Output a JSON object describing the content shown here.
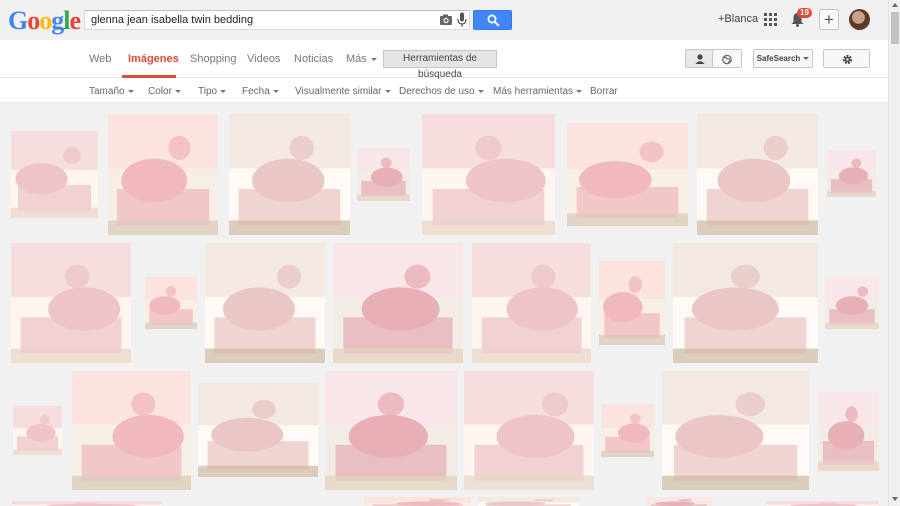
{
  "logo": {
    "letters": [
      "G",
      "o",
      "o",
      "g",
      "l",
      "e"
    ],
    "colors": [
      "#4285f4",
      "#ea4335",
      "#fbbc05",
      "#4285f4",
      "#34a853",
      "#ea4335"
    ]
  },
  "search": {
    "query": "glenna jean isabella twin bedding"
  },
  "header": {
    "user_link": "+Blanca",
    "notification_count": "19"
  },
  "nav": {
    "tabs": [
      {
        "label": "Web",
        "active": false
      },
      {
        "label": "Imágenes",
        "active": true
      },
      {
        "label": "Shopping",
        "active": false
      },
      {
        "label": "Videos",
        "active": false
      },
      {
        "label": "Noticias",
        "active": false
      },
      {
        "label": "Más",
        "active": false
      }
    ],
    "tools_button": "Herramientas de búsqueda",
    "safesearch": "SafeSearch"
  },
  "tools": [
    {
      "label": "Tamaño"
    },
    {
      "label": "Color"
    },
    {
      "label": "Tipo"
    },
    {
      "label": "Fecha"
    },
    {
      "label": "Visualmente similar"
    },
    {
      "label": "Derechos de uso"
    },
    {
      "label": "Más herramientas"
    },
    {
      "label": "Borrar"
    }
  ],
  "colors": {
    "accent": "#dd4b39",
    "button_blue": "#4285f4",
    "thumb_pink": "#f2c4c8",
    "thumb_cream": "#efe6dc"
  }
}
